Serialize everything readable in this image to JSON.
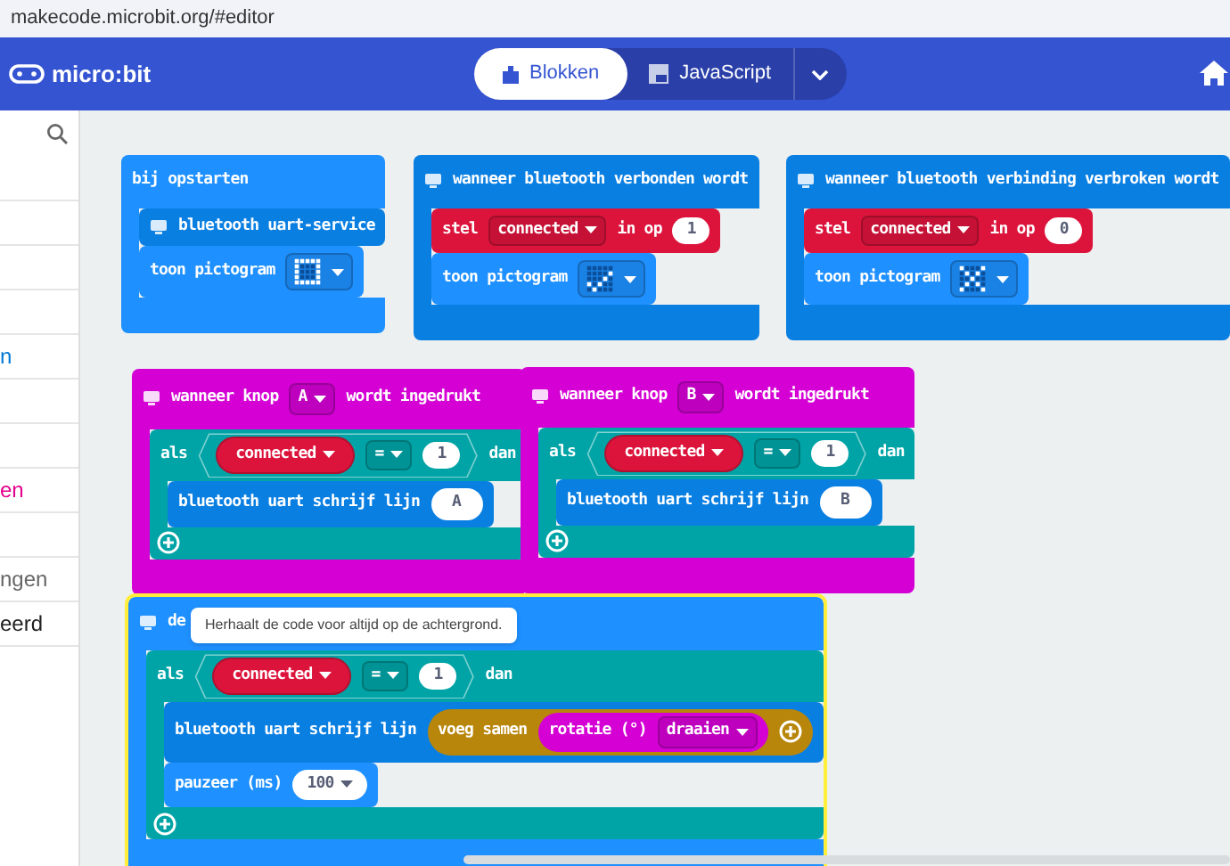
{
  "address_bar": {
    "url": "makecode.microbit.org/#editor"
  },
  "header": {
    "logo": "micro:bit",
    "tabs": [
      {
        "label": "Blokken",
        "selected": true,
        "kind": "blocks"
      },
      {
        "label": "JavaScript",
        "selected": false,
        "kind": "js"
      }
    ]
  },
  "sidebar": {
    "items": [
      {
        "kind": "blank"
      },
      {
        "kind": "blank"
      },
      {
        "kind": "blank"
      },
      {
        "kind": "text",
        "label": "n",
        "color": "#0078d7"
      },
      {
        "kind": "blank"
      },
      {
        "kind": "blank"
      },
      {
        "kind": "text",
        "label": "en",
        "color": "#e3008c"
      },
      {
        "kind": "blank"
      },
      {
        "kind": "text",
        "label": "ngen",
        "color": "#666666"
      },
      {
        "kind": "text",
        "label": "eerd",
        "color": "#222222"
      }
    ]
  },
  "canvas": {
    "stacks": [
      {
        "color": "#1e90ff",
        "selected": false,
        "header": [
          {
            "kind": "label",
            "text": "bij opstarten"
          }
        ],
        "body": [
          {
            "kind": "statement",
            "color": "#0a7fe2",
            "parts": [
              {
                "kind": "icon"
              },
              {
                "kind": "label",
                "text": "bluetooth uart-service"
              }
            ]
          },
          {
            "kind": "statement",
            "color": "#1e90ff",
            "parts": [
              {
                "kind": "label",
                "text": "toon pictogram"
              },
              {
                "kind": "leds",
                "lit": [
                  true,
                  true,
                  true,
                  true,
                  true,
                  true,
                  false,
                  false,
                  false,
                  true,
                  true,
                  false,
                  false,
                  false,
                  true,
                  true,
                  false,
                  false,
                  false,
                  true,
                  true,
                  true,
                  true,
                  true,
                  true
                ]
              }
            ]
          }
        ]
      },
      {
        "color": "#0a7fe2",
        "selected": false,
        "header": [
          {
            "kind": "icon"
          },
          {
            "kind": "label",
            "text": "wanneer bluetooth verbonden wordt"
          }
        ],
        "body": [
          {
            "kind": "statement",
            "color": "#dc143c",
            "parts": [
              {
                "kind": "label",
                "text": "stel"
              },
              {
                "kind": "dropdown",
                "text": "connected"
              },
              {
                "kind": "label",
                "text": "in op"
              },
              {
                "kind": "number",
                "text": "1"
              }
            ]
          },
          {
            "kind": "statement",
            "color": "#1e90ff",
            "parts": [
              {
                "kind": "label",
                "text": "toon pictogram"
              },
              {
                "kind": "leds",
                "lit": [
                  false,
                  false,
                  false,
                  false,
                  false,
                  false,
                  false,
                  false,
                  false,
                  true,
                  false,
                  false,
                  false,
                  true,
                  false,
                  true,
                  false,
                  true,
                  false,
                  false,
                  false,
                  true,
                  false,
                  false,
                  false
                ]
              }
            ]
          }
        ]
      },
      {
        "color": "#0a7fe2",
        "selected": false,
        "header": [
          {
            "kind": "icon"
          },
          {
            "kind": "label",
            "text": "wanneer bluetooth verbinding verbroken wordt"
          }
        ],
        "body": [
          {
            "kind": "statement",
            "color": "#dc143c",
            "parts": [
              {
                "kind": "label",
                "text": "stel"
              },
              {
                "kind": "dropdown",
                "text": "connected"
              },
              {
                "kind": "label",
                "text": "in op"
              },
              {
                "kind": "number",
                "text": "0"
              }
            ]
          },
          {
            "kind": "statement",
            "color": "#1e90ff",
            "parts": [
              {
                "kind": "label",
                "text": "toon pictogram"
              },
              {
                "kind": "leds",
                "lit": [
                  true,
                  false,
                  false,
                  false,
                  true,
                  false,
                  true,
                  false,
                  true,
                  false,
                  false,
                  false,
                  true,
                  false,
                  false,
                  false,
                  true,
                  false,
                  true,
                  false,
                  true,
                  false,
                  false,
                  false,
                  true
                ]
              }
            ]
          }
        ]
      },
      {
        "color": "#d400d4",
        "selected": false,
        "header": [
          {
            "kind": "icon"
          },
          {
            "kind": "label",
            "text": "wanneer knop"
          },
          {
            "kind": "dropdown",
            "text": "A"
          },
          {
            "kind": "label",
            "text": "wordt ingedrukt"
          }
        ],
        "body": [
          {
            "kind": "if",
            "color": "#00a4a6",
            "header": [
              {
                "kind": "label",
                "text": "als"
              },
              {
                "kind": "condition",
                "parts": [
                  {
                    "kind": "variable",
                    "text": "connected"
                  },
                  {
                    "kind": "dropdown",
                    "text": "="
                  },
                  {
                    "kind": "number",
                    "text": "1"
                  }
                ]
              },
              {
                "kind": "label",
                "text": "dan"
              }
            ],
            "body": [
              {
                "kind": "statement",
                "color": "#0a7fe2",
                "parts": [
                  {
                    "kind": "label",
                    "text": "bluetooth uart schrijf lijn"
                  },
                  {
                    "kind": "string",
                    "text": "A"
                  }
                ]
              }
            ]
          }
        ]
      },
      {
        "color": "#d400d4",
        "selected": false,
        "header": [
          {
            "kind": "icon"
          },
          {
            "kind": "label",
            "text": "wanneer knop"
          },
          {
            "kind": "dropdown",
            "text": "B"
          },
          {
            "kind": "label",
            "text": "wordt ingedrukt"
          }
        ],
        "body": [
          {
            "kind": "if",
            "color": "#00a4a6",
            "header": [
              {
                "kind": "label",
                "text": "als"
              },
              {
                "kind": "condition",
                "parts": [
                  {
                    "kind": "variable",
                    "text": "connected"
                  },
                  {
                    "kind": "dropdown",
                    "text": "="
                  },
                  {
                    "kind": "number",
                    "text": "1"
                  }
                ]
              },
              {
                "kind": "label",
                "text": "dan"
              }
            ],
            "body": [
              {
                "kind": "statement",
                "color": "#0a7fe2",
                "parts": [
                  {
                    "kind": "label",
                    "text": "bluetooth uart schrijf lijn"
                  },
                  {
                    "kind": "string",
                    "text": "B"
                  }
                ]
              }
            ]
          }
        ]
      },
      {
        "color": "#1e90ff",
        "selected": true,
        "header": [
          {
            "kind": "icon"
          },
          {
            "kind": "label",
            "text": "de"
          }
        ],
        "body": [
          {
            "kind": "if",
            "color": "#00a4a6",
            "header": [
              {
                "kind": "label",
                "text": "als"
              },
              {
                "kind": "condition",
                "parts": [
                  {
                    "kind": "variable",
                    "text": "connected"
                  },
                  {
                    "kind": "dropdown",
                    "text": "="
                  },
                  {
                    "kind": "number",
                    "text": "1"
                  }
                ]
              },
              {
                "kind": "label",
                "text": "dan"
              }
            ],
            "body": [
              {
                "kind": "statement",
                "color": "#0a7fe2",
                "parts": [
                  {
                    "kind": "label",
                    "text": "bluetooth uart schrijf lijn"
                  },
                  {
                    "kind": "reporter",
                    "color": "#b8860b",
                    "parts": [
                      {
                        "kind": "label",
                        "text": "voeg samen"
                      },
                      {
                        "kind": "reporter",
                        "color": "#d400d4",
                        "parts": [
                          {
                            "kind": "label",
                            "text": "rotatie (°)"
                          },
                          {
                            "kind": "dropdown",
                            "text": "draaien"
                          }
                        ]
                      },
                      {
                        "kind": "plus"
                      }
                    ]
                  }
                ]
              },
              {
                "kind": "statement",
                "color": "#1e90ff",
                "parts": [
                  {
                    "kind": "label",
                    "text": "pauzeer (ms)"
                  },
                  {
                    "kind": "number_dropdown",
                    "text": "100"
                  }
                ]
              }
            ]
          }
        ]
      }
    ],
    "tooltip": "Herhaalt de code voor altijd op de achtergrond."
  }
}
